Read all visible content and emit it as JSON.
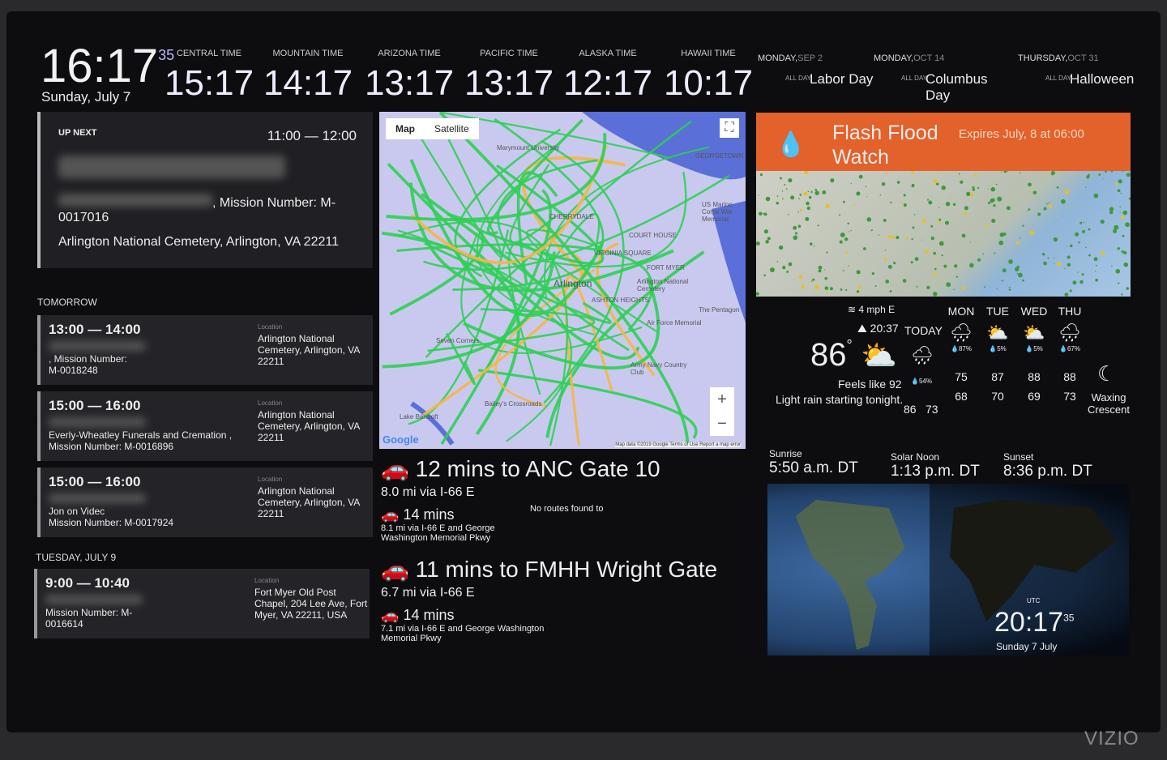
{
  "clock": {
    "time": "16:17",
    "seconds": "35",
    "date": "Sunday, July 7"
  },
  "timezones": [
    {
      "label": "CENTRAL TIME",
      "time": "15:17"
    },
    {
      "label": "MOUNTAIN TIME",
      "time": "14:17"
    },
    {
      "label": "ARIZONA TIME",
      "time": "13:17"
    },
    {
      "label": "PACIFIC TIME",
      "time": "13:17"
    },
    {
      "label": "ALASKA TIME",
      "time": "12:17"
    },
    {
      "label": "HAWAII TIME",
      "time": "10:17"
    }
  ],
  "holidays": [
    {
      "day": "MONDAY,",
      "date": "SEP 2",
      "name": "Labor Day",
      "badge": "ALL DAY"
    },
    {
      "day": "MONDAY,",
      "date": "OCT 14",
      "name": "Columbus Day",
      "badge": "ALL DAY"
    },
    {
      "day": "THURSDAY,",
      "date": "OCT 31",
      "name": "Halloween",
      "badge": "ALL DAY"
    }
  ],
  "upnext": {
    "label": "UP NEXT",
    "time": "11:00  —  12:00",
    "mission": ", Mission Number: M-",
    "mission2": "0017016",
    "location": "Arlington National Cemetery, Arlington, VA 22211"
  },
  "sections": {
    "tomorrow": "TOMORROW",
    "tuesday": "TUESDAY, JULY 9"
  },
  "events": [
    {
      "time": "13:00 — 14:00",
      "desc": ", Mission Number:",
      "desc2": "M-0018248",
      "loc_label": "Location",
      "location": "Arlington National Cemetery, Arlington, VA 22211"
    },
    {
      "time": "15:00 — 16:00",
      "desc": "Everly-Wheatley Funerals and Cremation ,",
      "desc2": "Mission Number: M-0016896",
      "loc_label": "Location",
      "location": "Arlington National Cemetery, Arlington, VA 22211"
    },
    {
      "time": "15:00 — 16:00",
      "desc": "Jon on Videc",
      "desc2": "Mission Number: M-0017924",
      "loc_label": "Location",
      "location": "Arlington National Cemetery, Arlington, VA 22211"
    },
    {
      "time": "9:00 — 10:40",
      "desc": "Mission Number: M-",
      "desc2": "0016614",
      "loc_label": "Location",
      "location": "Fort Myer Old Post Chapel, 204 Lee Ave, Fort Myer, VA 22211, USA"
    }
  ],
  "map": {
    "tab_map": "Map",
    "tab_satellite": "Satellite",
    "labels": [
      "Arlington",
      "CHERRYDALE",
      "COURT HOUSE",
      "VIRGINIA SQUARE",
      "ASHTON HEIGHTS",
      "FORT MYER",
      "Arlington National Cemetery",
      "Seven Corners",
      "Lake Barcroft",
      "GEORGETOWN",
      "The Pentagon",
      "Air Force Memorial",
      "Army Navy Country Club",
      "Bailey's Crossroads",
      "US Marine Corps War Memorial",
      "Marymount University"
    ],
    "logo": "Google",
    "attribution": "Map data ©2019 Google  Terms of Use  Report a map error"
  },
  "routes": [
    {
      "title": "12 mins to ANC Gate 10",
      "via": "8.0 mi via I-66 E",
      "alt": "14 mins",
      "alt_via": "8.1 mi via I-66 E and George Washington Memorial Pkwy",
      "note": "No routes found to"
    },
    {
      "title": "11 mins to FMHH Wright Gate",
      "via": "6.7 mi via I-66 E",
      "alt": "14 mins",
      "alt_via": "7.1 mi via I-66 E and George Washington Memorial Pkwy"
    }
  ],
  "alert": {
    "title": "Flash Flood Watch",
    "expires": "Expires July, 8 at 06:00",
    "color": "#e3612a"
  },
  "weather": {
    "wind": "4 mph E",
    "sunset_time": "20:37",
    "temp": "86",
    "feels": "Feels like 92",
    "summary": "Light rain starting tonight.",
    "today": {
      "label": "TODAY",
      "precip": "54%",
      "high": "86",
      "low": "73"
    },
    "forecast": [
      {
        "day": "MON",
        "precip": "87%",
        "high": "75",
        "low": "68",
        "icon": "rain"
      },
      {
        "day": "TUE",
        "precip": "5%",
        "high": "87",
        "low": "70",
        "icon": "partly-sunny"
      },
      {
        "day": "WED",
        "precip": "5%",
        "high": "88",
        "low": "69",
        "icon": "partly-sunny"
      },
      {
        "day": "THU",
        "precip": "67%",
        "high": "88",
        "low": "73",
        "icon": "rain"
      }
    ],
    "moon": "Waxing Crescent"
  },
  "sun": {
    "sunrise_label": "Sunrise",
    "sunrise": "5:50 a.m. DT",
    "noon_label": "Solar Noon",
    "noon": "1:13 p.m. DT",
    "sunset_label": "Sunset",
    "sunset": "8:36 p.m. DT"
  },
  "utc": {
    "label": "UTC",
    "time": "20:17",
    "seconds": "35",
    "date": "Sunday 7 July"
  },
  "brand": "VIZIO"
}
